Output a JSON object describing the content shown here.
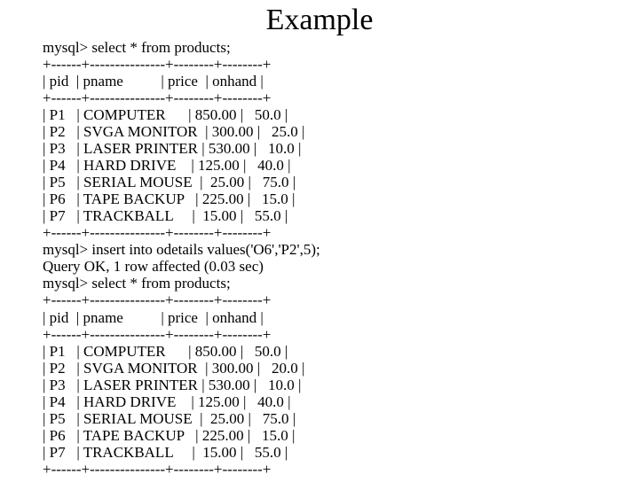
{
  "title": "Example",
  "lines": [
    "mysql> select * from products;",
    "+------+---------------+--------+--------+",
    "| pid  | pname          | price  | onhand |",
    "+------+---------------+--------+--------+",
    "| P1   | COMPUTER      | 850.00 |   50.0 |",
    "| P2   | SVGA MONITOR  | 300.00 |   25.0 |",
    "| P3   | LASER PRINTER | 530.00 |   10.0 |",
    "| P4   | HARD DRIVE    | 125.00 |   40.0 |",
    "| P5   | SERIAL MOUSE  |  25.00 |   75.0 |",
    "| P6   | TAPE BACKUP   | 225.00 |   15.0 |",
    "| P7   | TRACKBALL     |  15.00 |   55.0 |",
    "+------+---------------+--------+--------+",
    "mysql> insert into odetails values('O6','P2',5);",
    "Query OK, 1 row affected (0.03 sec)",
    "mysql> select * from products;",
    "+------+---------------+--------+--------+",
    "| pid  | pname          | price  | onhand |",
    "+------+---------------+--------+--------+",
    "| P1   | COMPUTER      | 850.00 |   50.0 |",
    "| P2   | SVGA MONITOR  | 300.00 |   20.0 |",
    "| P3   | LASER PRINTER | 530.00 |   10.0 |",
    "| P4   | HARD DRIVE    | 125.00 |   40.0 |",
    "| P5   | SERIAL MOUSE  |  25.00 |   75.0 |",
    "| P6   | TAPE BACKUP   | 225.00 |   15.0 |",
    "| P7   | TRACKBALL     |  15.00 |   55.0 |",
    "+------+---------------+--------+--------+"
  ]
}
